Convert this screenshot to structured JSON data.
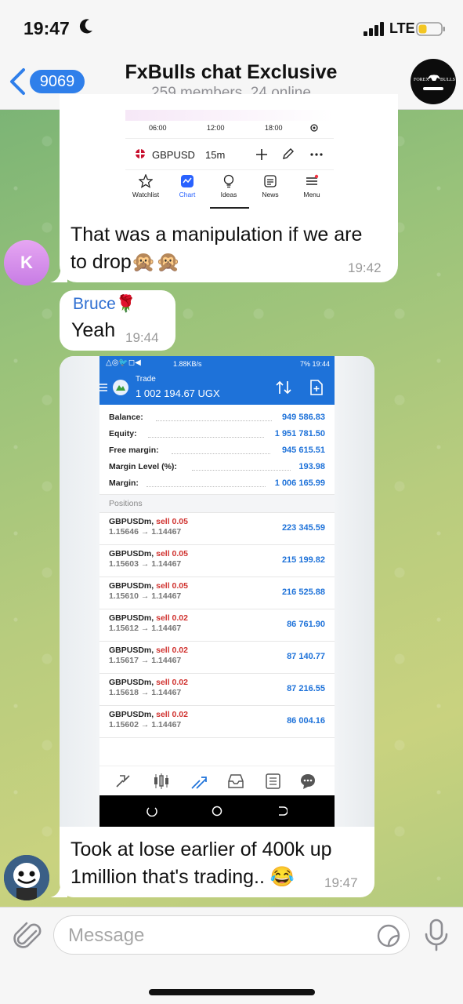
{
  "status_bar": {
    "time": "19:47",
    "network": "LTE"
  },
  "header": {
    "back_count": "9069",
    "title": "FxBulls chat Exclusive",
    "subtitle": "259 members, 24 online",
    "avatar_text_left": "FOREX",
    "avatar_text_right": "BULLS"
  },
  "messages": [
    {
      "type": "image_with_caption",
      "image": {
        "times": [
          "06:00",
          "12:00",
          "18:00"
        ],
        "symbol": "GBPUSD",
        "timeframe": "15m",
        "nav": [
          "Watchlist",
          "Chart",
          "Ideas",
          "News",
          "Menu"
        ]
      },
      "text_line1": "That was a manipulation if we are",
      "text_line2": "to drop🙊🙊",
      "time": "19:42",
      "sender_initial": "K"
    },
    {
      "type": "text",
      "sender": "Bruce🌹",
      "text": "Yeah",
      "time": "19:44"
    },
    {
      "type": "image_with_caption",
      "image": {
        "status_left": "△◎🐦◻◀",
        "status_speed": "1.88KB/s",
        "status_right": "7% 19:44",
        "appbar_title": "Trade",
        "appbar_amount": "1 002 194.67 UGX",
        "summary": [
          {
            "label": "Balance:",
            "value": "949 586.83"
          },
          {
            "label": "Equity:",
            "value": "1 951 781.50"
          },
          {
            "label": "Free margin:",
            "value": "945 615.51"
          },
          {
            "label": "Margin Level (%):",
            "value": "193.98"
          },
          {
            "label": "Margin:",
            "value": "1 006 165.99"
          }
        ],
        "positions_header": "Positions",
        "positions": [
          {
            "symbol": "GBPUSDm,",
            "side": "sell 0.05",
            "prices": "1.15646 → 1.14467",
            "profit": "223 345.59"
          },
          {
            "symbol": "GBPUSDm,",
            "side": "sell 0.05",
            "prices": "1.15603 → 1.14467",
            "profit": "215 199.82"
          },
          {
            "symbol": "GBPUSDm,",
            "side": "sell 0.05",
            "prices": "1.15610 → 1.14467",
            "profit": "216 525.88"
          },
          {
            "symbol": "GBPUSDm,",
            "side": "sell 0.02",
            "prices": "1.15612 → 1.14467",
            "profit": "86 761.90"
          },
          {
            "symbol": "GBPUSDm,",
            "side": "sell 0.02",
            "prices": "1.15617 → 1.14467",
            "profit": "87 140.77"
          },
          {
            "symbol": "GBPUSDm,",
            "side": "sell 0.02",
            "prices": "1.15618 → 1.14467",
            "profit": "87 216.55"
          },
          {
            "symbol": "GBPUSDm,",
            "side": "sell 0.02",
            "prices": "1.15602 → 1.14467",
            "profit": "86 004.16"
          }
        ]
      },
      "text_line1": "Took at lose earlier of 400k up",
      "text_line2": "1million that's trading.. 😂",
      "time": "19:47"
    }
  ],
  "input": {
    "placeholder": "Message"
  },
  "colors": {
    "accent": "#2f7fea",
    "trade_blue": "#1e72d9",
    "sell_red": "#d0322f"
  }
}
